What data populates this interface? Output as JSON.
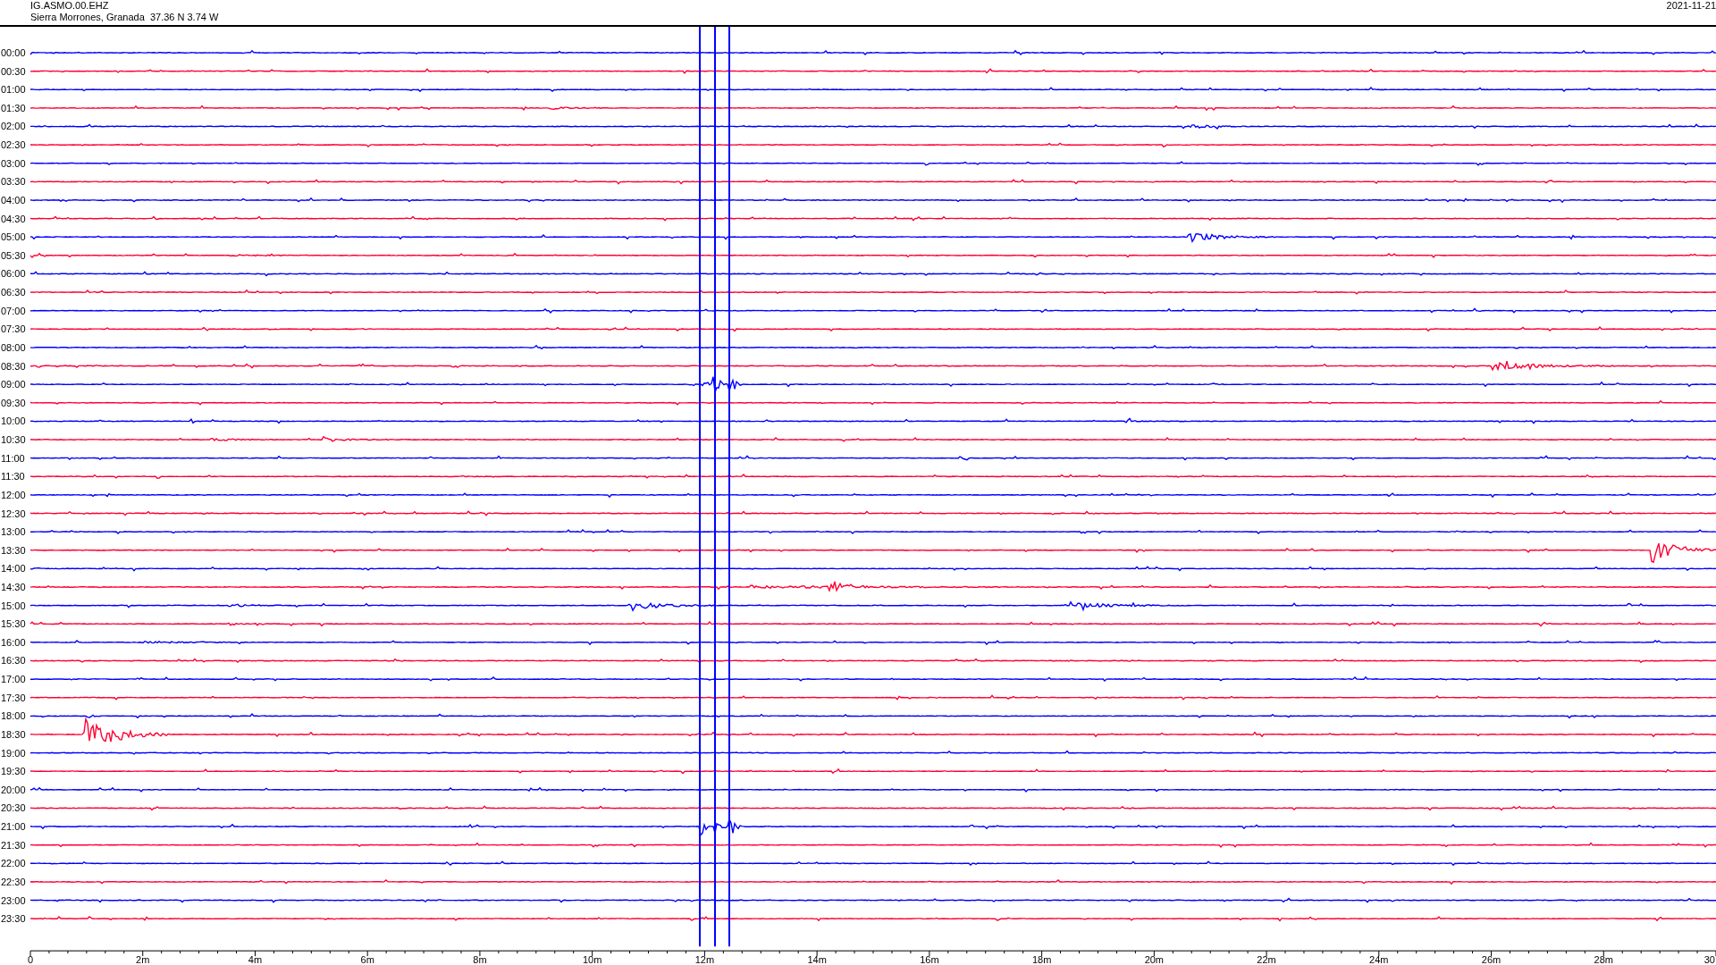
{
  "header": {
    "station": "IG.ASMO.00.EHZ",
    "location": "Sierra Morrones, Granada  37.36 N 3.74 W",
    "date": "2021-11-21"
  },
  "helicorder": {
    "rows": [
      {
        "label": "00:00",
        "color": "#0000ff"
      },
      {
        "label": "00:30",
        "color": "#ff0033"
      },
      {
        "label": "01:00",
        "color": "#0000ff"
      },
      {
        "label": "01:30",
        "color": "#ff0033"
      },
      {
        "label": "02:00",
        "color": "#0000ff"
      },
      {
        "label": "02:30",
        "color": "#ff0033"
      },
      {
        "label": "03:00",
        "color": "#0000ff"
      },
      {
        "label": "03:30",
        "color": "#ff0033"
      },
      {
        "label": "04:00",
        "color": "#0000ff"
      },
      {
        "label": "04:30",
        "color": "#ff0033"
      },
      {
        "label": "05:00",
        "color": "#0000ff"
      },
      {
        "label": "05:30",
        "color": "#ff0033"
      },
      {
        "label": "06:00",
        "color": "#0000ff"
      },
      {
        "label": "06:30",
        "color": "#ff0033"
      },
      {
        "label": "07:00",
        "color": "#0000ff"
      },
      {
        "label": "07:30",
        "color": "#ff0033"
      },
      {
        "label": "08:00",
        "color": "#0000ff"
      },
      {
        "label": "08:30",
        "color": "#ff0033"
      },
      {
        "label": "09:00",
        "color": "#0000ff"
      },
      {
        "label": "09:30",
        "color": "#ff0033"
      },
      {
        "label": "10:00",
        "color": "#0000ff"
      },
      {
        "label": "10:30",
        "color": "#ff0033"
      },
      {
        "label": "11:00",
        "color": "#0000ff"
      },
      {
        "label": "11:30",
        "color": "#ff0033"
      },
      {
        "label": "12:00",
        "color": "#0000ff"
      },
      {
        "label": "12:30",
        "color": "#ff0033"
      },
      {
        "label": "13:00",
        "color": "#0000ff"
      },
      {
        "label": "13:30",
        "color": "#ff0033"
      },
      {
        "label": "14:00",
        "color": "#0000ff"
      },
      {
        "label": "14:30",
        "color": "#ff0033"
      },
      {
        "label": "15:00",
        "color": "#0000ff"
      },
      {
        "label": "15:30",
        "color": "#ff0033"
      },
      {
        "label": "16:00",
        "color": "#0000ff"
      },
      {
        "label": "16:30",
        "color": "#ff0033"
      },
      {
        "label": "17:00",
        "color": "#0000ff"
      },
      {
        "label": "17:30",
        "color": "#ff0033"
      },
      {
        "label": "18:00",
        "color": "#0000ff"
      },
      {
        "label": "18:30",
        "color": "#ff0033"
      },
      {
        "label": "19:00",
        "color": "#0000ff"
      },
      {
        "label": "19:30",
        "color": "#ff0033"
      },
      {
        "label": "20:00",
        "color": "#0000ff"
      },
      {
        "label": "20:30",
        "color": "#ff0033"
      },
      {
        "label": "21:00",
        "color": "#0000ff"
      },
      {
        "label": "21:30",
        "color": "#ff0033"
      },
      {
        "label": "22:00",
        "color": "#0000ff"
      },
      {
        "label": "22:30",
        "color": "#ff0033"
      },
      {
        "label": "23:00",
        "color": "#0000ff"
      },
      {
        "label": "23:30",
        "color": "#ff0033"
      }
    ],
    "x_axis": {
      "ticks": [
        "0",
        "2m",
        "4m",
        "6m",
        "8m",
        "10m",
        "12m",
        "14m",
        "16m",
        "18m",
        "20m",
        "22m",
        "24m",
        "26m",
        "28m",
        "30"
      ]
    }
  }
}
